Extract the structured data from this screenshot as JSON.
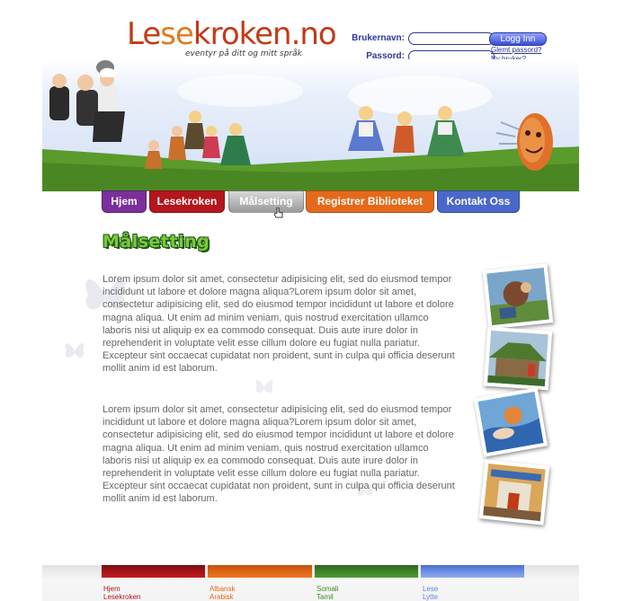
{
  "brand": {
    "logo_part1": "Le",
    "logo_part2": "se",
    "logo_part3": "kroken.no",
    "tagline": "eventyr på ditt og mitt språk"
  },
  "login": {
    "username_label": "Brukernavn:",
    "password_label": "Passord:",
    "button_label": "Logg Inn",
    "forgot_password": "Glemt passord?",
    "new_user": "Ny bruker?"
  },
  "nav": {
    "tabs": [
      {
        "label": "Hjem",
        "color": "#7b2f9a"
      },
      {
        "label": "Lesekroken",
        "color": "#b3161c"
      },
      {
        "label": "Målsetting",
        "color": "#9a9a9a"
      },
      {
        "label": "Registrer Biblioteket",
        "color": "#e5691a"
      },
      {
        "label": "Kontakt Oss",
        "color": "#4a68c9"
      }
    ],
    "active": "Målsetting"
  },
  "main": {
    "title": "Målsetting",
    "paragraphs": [
      "Lorem ipsum dolor sit amet, consectetur adipisicing elit, sed do eiusmod tempor incididunt ut labore et dolore magna aliqua?Lorem ipsum dolor sit amet, consectetur adipisicing elit, sed do eiusmod tempor incididunt ut labore et dolore magna aliqua. Ut enim ad minim veniam, quis nostrud exercitation ullamco laboris nisi ut aliquip ex ea commodo consequat. Duis aute irure dolor in reprehenderit in voluptate velit esse cillum dolore eu fugiat nulla pariatur. Excepteur sint occaecat cupidatat non proident, sunt in culpa qui officia deserunt mollit anim id est laborum.",
      "Lorem ipsum dolor sit amet, consectetur adipisicing elit, sed do eiusmod tempor incididunt ut labore et dolore magna aliqua?Lorem ipsum dolor sit amet, consectetur adipisicing elit, sed do eiusmod tempor incididunt ut labore et dolore magna aliqua. Ut enim ad minim veniam, quis nostrud exercitation ullamco laboris nisi ut aliquip ex ea commodo consequat. Duis aute irure dolor in reprehenderit in voluptate velit esse cillum dolore eu fugiat nulla pariatur. Excepteur sint occaecat cupidatat non proident, sunt in culpa qui officia deserunt mollit anim id est laborum."
    ]
  },
  "footer": {
    "columns": [
      {
        "color": "#b3161c",
        "links": [
          "Hjem",
          "Lesekroken"
        ]
      },
      {
        "color": "#e5691a",
        "links": [
          "Albansk",
          "Arabisk"
        ]
      },
      {
        "color": "#3f8a2b",
        "links": [
          "Somali",
          "Tamil"
        ]
      },
      {
        "color": "#5f86de",
        "links": [
          "Lese",
          "Lytte"
        ]
      }
    ]
  },
  "colors": {
    "brand_red": "#c23a17",
    "brand_orange": "#e27a1c",
    "login_blue": "#2d3a96",
    "title_green": "#7ac93b",
    "body_text": "#666666"
  }
}
